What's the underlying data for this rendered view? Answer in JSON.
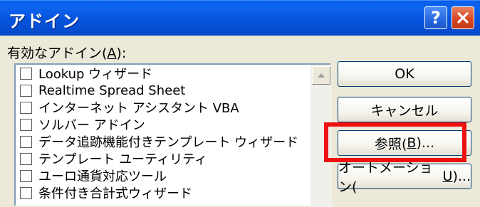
{
  "window": {
    "title": "アドイン",
    "help_icon": "question-mark-icon",
    "close_icon": "close-x-icon"
  },
  "addins": {
    "label_prefix": "有効なアドイン(",
    "label_accel": "A",
    "label_suffix": "):",
    "items": [
      {
        "label": "Lookup ウィザード",
        "checked": false
      },
      {
        "label": "Realtime Spread Sheet",
        "checked": false
      },
      {
        "label": "インターネット アシスタント VBA",
        "checked": false
      },
      {
        "label": "ソルバー アドイン",
        "checked": false
      },
      {
        "label": "データ追跡機能付きテンプレート ウィザード",
        "checked": false
      },
      {
        "label": "テンプレート ユーティリティ",
        "checked": false
      },
      {
        "label": "ユーロ通貨対応ツール",
        "checked": false
      },
      {
        "label": "条件付き合計式ウィザード",
        "checked": false
      }
    ]
  },
  "buttons": {
    "ok": "OK",
    "cancel": "キャンセル",
    "browse_prefix": "参照(",
    "browse_accel": "B",
    "browse_suffix": ")...",
    "automation_prefix": "オートメーション(",
    "automation_accel": "U",
    "automation_suffix": ")..."
  },
  "colors": {
    "titlebar": "#0553DD",
    "highlight": "#EE1111",
    "dialog_bg": "#ECE9D8"
  }
}
